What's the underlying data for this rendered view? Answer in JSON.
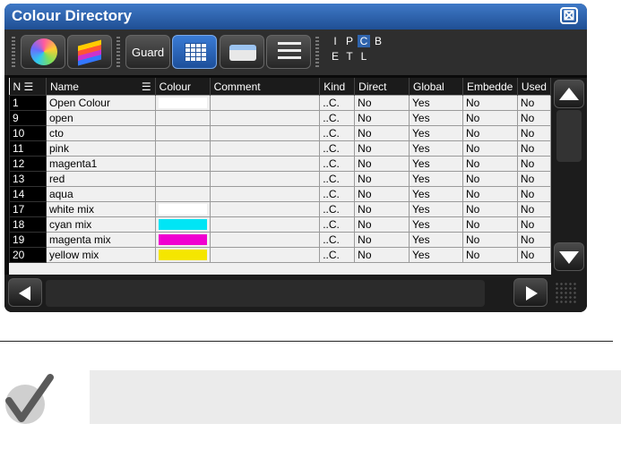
{
  "window": {
    "title": "Colour Directory",
    "close_symbol": "⊠"
  },
  "toolbar": {
    "guard_label": "Guard",
    "filter_letters_row1": [
      "I",
      "P",
      "C",
      "B"
    ],
    "filter_letters_row2": [
      "E",
      "T",
      "L"
    ],
    "active_filter": "C"
  },
  "table": {
    "headers": [
      "N",
      "Name",
      "Colour",
      "Comment",
      "Kind",
      "Direct",
      "Global",
      "Embedde",
      "Used"
    ],
    "rows": [
      {
        "n": "1",
        "name": "Open Colour",
        "colour": "#ffffff",
        "comment": "",
        "kind": "..C.",
        "direct": "No",
        "global": "Yes",
        "embedded": "No",
        "used": "No"
      },
      {
        "n": "9",
        "name": "open",
        "colour": "",
        "comment": "",
        "kind": "..C.",
        "direct": "No",
        "global": "Yes",
        "embedded": "No",
        "used": "No"
      },
      {
        "n": "10",
        "name": "cto",
        "colour": "",
        "comment": "",
        "kind": "..C.",
        "direct": "No",
        "global": "Yes",
        "embedded": "No",
        "used": "No"
      },
      {
        "n": "11",
        "name": "pink",
        "colour": "",
        "comment": "",
        "kind": "..C.",
        "direct": "No",
        "global": "Yes",
        "embedded": "No",
        "used": "No"
      },
      {
        "n": "12",
        "name": "magenta1",
        "colour": "",
        "comment": "",
        "kind": "..C.",
        "direct": "No",
        "global": "Yes",
        "embedded": "No",
        "used": "No"
      },
      {
        "n": "13",
        "name": "red",
        "colour": "",
        "comment": "",
        "kind": "..C.",
        "direct": "No",
        "global": "Yes",
        "embedded": "No",
        "used": "No"
      },
      {
        "n": "14",
        "name": "aqua",
        "colour": "",
        "comment": "",
        "kind": "..C.",
        "direct": "No",
        "global": "Yes",
        "embedded": "No",
        "used": "No"
      },
      {
        "n": "17",
        "name": "white mix",
        "colour": "#ffffff",
        "comment": "",
        "kind": "..C.",
        "direct": "No",
        "global": "Yes",
        "embedded": "No",
        "used": "No"
      },
      {
        "n": "18",
        "name": "cyan mix",
        "colour": "#00e5f5",
        "comment": "",
        "kind": "..C.",
        "direct": "No",
        "global": "Yes",
        "embedded": "No",
        "used": "No"
      },
      {
        "n": "19",
        "name": "magenta mix",
        "colour": "#f000d0",
        "comment": "",
        "kind": "..C.",
        "direct": "No",
        "global": "Yes",
        "embedded": "No",
        "used": "No"
      },
      {
        "n": "20",
        "name": "yellow mix",
        "colour": "#f5e600",
        "comment": "",
        "kind": "..C.",
        "direct": "No",
        "global": "Yes",
        "embedded": "No",
        "used": "No"
      }
    ]
  },
  "colors": {
    "title_bar": "#2f64ad",
    "active_filter_bg": "#2f64ad",
    "window_bg": "#0a0a0a"
  },
  "icons": [
    "colour-wheel-icon",
    "gels-icon",
    "table-view-icon",
    "printer-icon",
    "checklist-icon",
    "scroll-up-icon",
    "scroll-down-icon",
    "scroll-left-icon",
    "scroll-right-icon",
    "checkmark-note-icon"
  ]
}
